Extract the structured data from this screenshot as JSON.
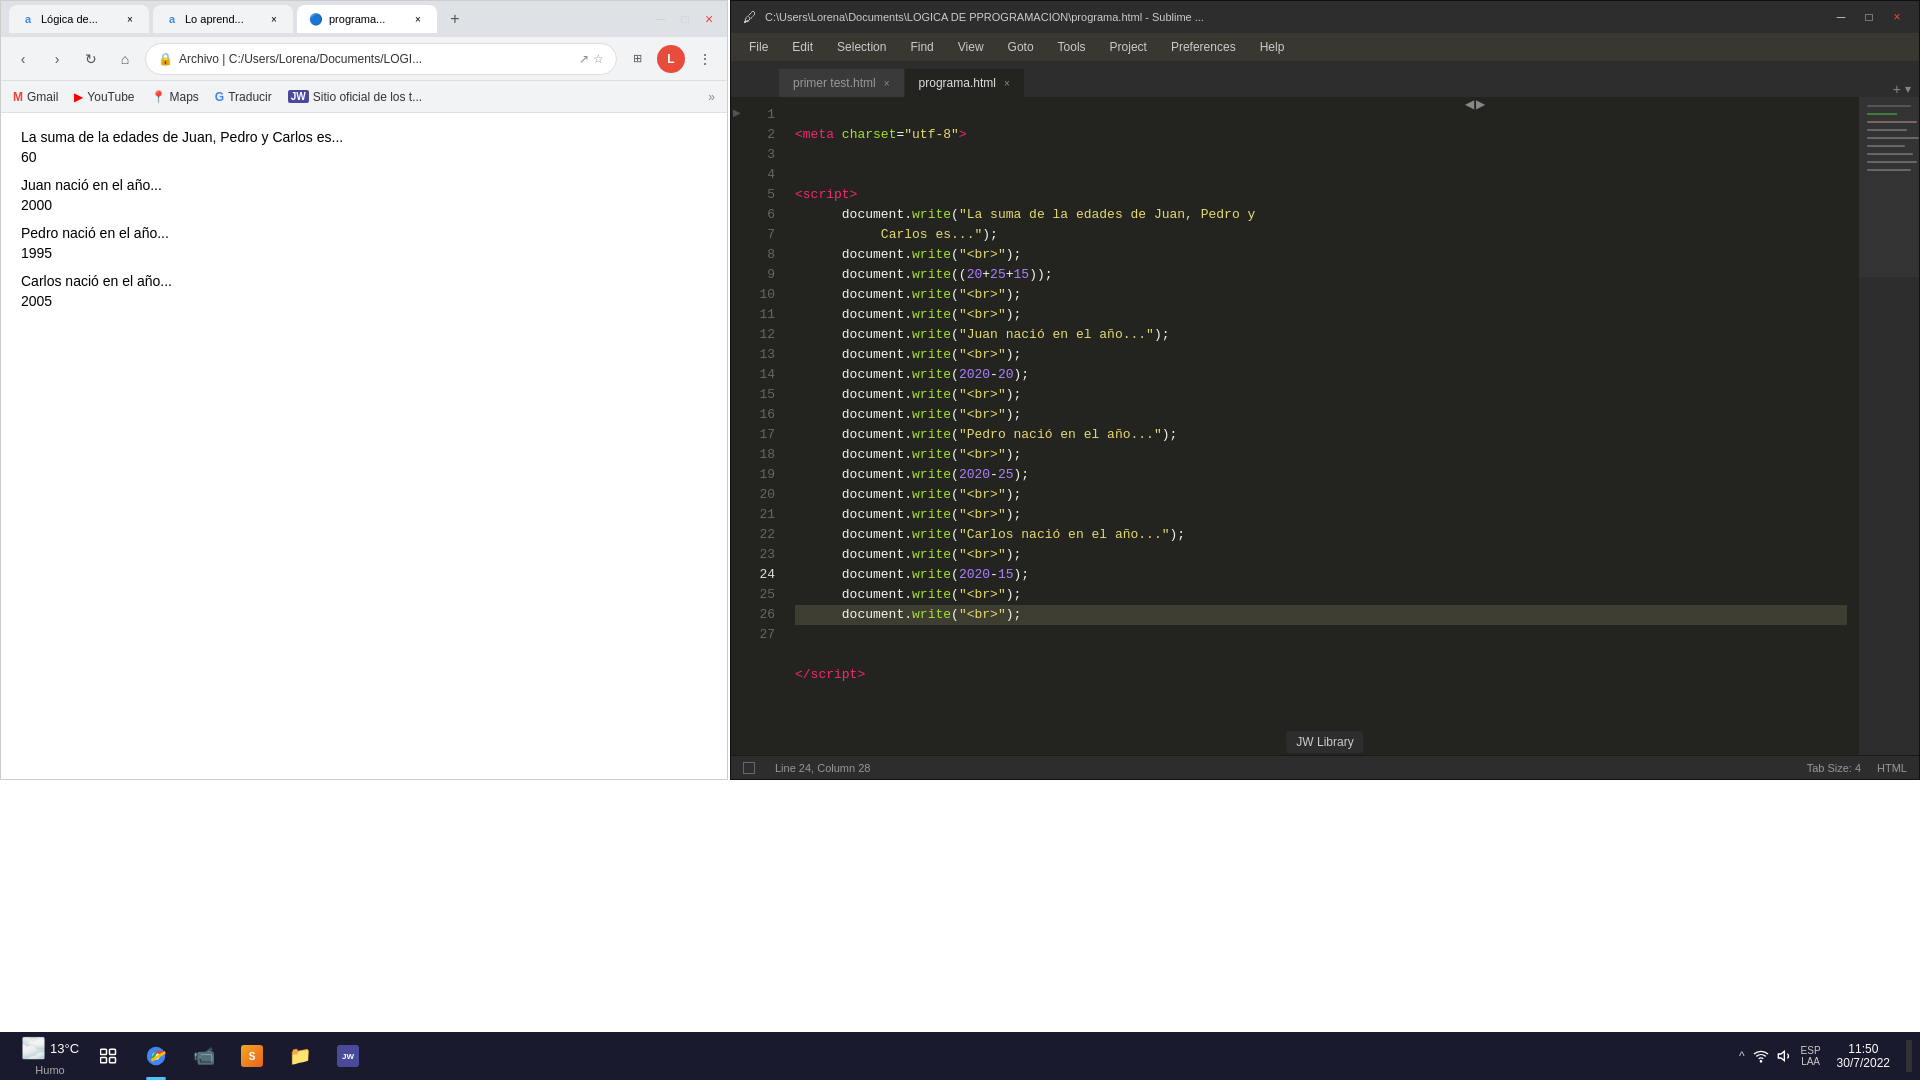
{
  "browser": {
    "tabs": [
      {
        "id": "tab1",
        "favicon": "a",
        "title": "Lógica de...",
        "active": false,
        "favicon_color": "#4285F4"
      },
      {
        "id": "tab2",
        "favicon": "a",
        "title": "Lo aprend...",
        "active": false,
        "favicon_color": "#4285F4"
      },
      {
        "id": "tab3",
        "favicon": "🔵",
        "title": "programa...",
        "active": true,
        "favicon_color": "#4285F4"
      }
    ],
    "address": "Archivo | C:/Users/Lorena/Documents/LOGI...",
    "bookmarks": [
      {
        "id": "gmail",
        "icon": "M",
        "label": "Gmail",
        "icon_color": "#EA4335"
      },
      {
        "id": "youtube",
        "icon": "▶",
        "label": "YouTube",
        "icon_color": "#FF0000"
      },
      {
        "id": "maps",
        "icon": "📍",
        "label": "Maps",
        "icon_color": "#34A853"
      },
      {
        "id": "traducir",
        "icon": "G",
        "label": "Traducir",
        "icon_color": "#4285F4"
      },
      {
        "id": "jw",
        "icon": "JW",
        "label": "Sitio oficial de los t...",
        "icon_color": "#636363"
      }
    ],
    "content": {
      "line1": "La suma de la edades de Juan, Pedro y Carlos es...",
      "line2": "60",
      "line3": "Juan nació en el año...",
      "line4": "2000",
      "line5": "Pedro nació en el año...",
      "line6": "1995",
      "line7": "Carlos nació en el año...",
      "line8": "2005"
    }
  },
  "sublime": {
    "titlebar": "C:\\Users\\Lorena\\Documents\\LOGICA DE PPROGRAMACION\\programa.html - Sublime ...",
    "menu": [
      "File",
      "Edit",
      "Selection",
      "Find",
      "View",
      "Goto",
      "Tools",
      "Project",
      "Preferences",
      "Help"
    ],
    "tabs": [
      {
        "label": "primer test.html",
        "active": false
      },
      {
        "label": "programa.html",
        "active": true
      }
    ],
    "statusbar": {
      "left": "Line 24, Column 28",
      "tab_size": "Tab Size: 4",
      "syntax": "HTML"
    },
    "tooltip": "JW Library"
  },
  "taskbar": {
    "weather_icon": "🌫️",
    "temperature": "13°C",
    "weather_desc": "Humo",
    "time": "11:50",
    "date": "30/7/2022",
    "locale": "ESP\nLAA"
  }
}
